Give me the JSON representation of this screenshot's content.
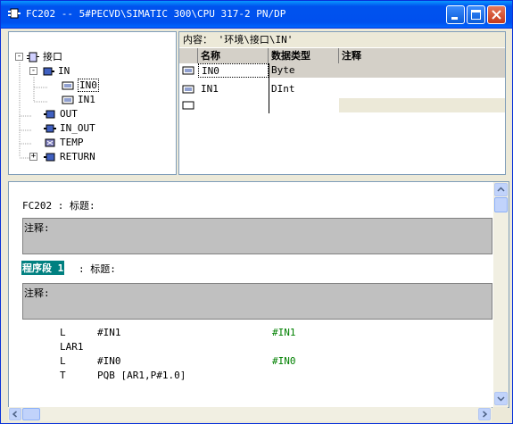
{
  "window": {
    "title": "FC202 -- 5#PECVD\\SIMATIC 300\\CPU 317-2 PN/DP"
  },
  "tree": {
    "items": [
      {
        "label": "接口",
        "icon": "interface-icon",
        "expander": "-"
      },
      {
        "label": "IN",
        "icon": "param-folder-icon",
        "expander": "-"
      },
      {
        "label": "IN0",
        "icon": "param-variable-icon"
      },
      {
        "label": "IN1",
        "icon": "param-variable-icon"
      },
      {
        "label": "OUT",
        "icon": "param-folder-icon"
      },
      {
        "label": "IN_OUT",
        "icon": "param-folder-icon"
      },
      {
        "label": "TEMP",
        "icon": "param-folder-icon"
      },
      {
        "label": "RETURN",
        "icon": "param-folder-icon",
        "expander": "+"
      }
    ]
  },
  "content": {
    "path_label": "内容：  '环境\\接口\\IN'",
    "columns": [
      "名称",
      "数据类型",
      "注释"
    ],
    "rows": [
      {
        "name": "IN0",
        "type": "Byte",
        "comment": ""
      },
      {
        "name": "IN1",
        "type": "DInt",
        "comment": ""
      },
      {
        "name": "",
        "type": "",
        "comment": ""
      }
    ]
  },
  "editor": {
    "block_title": "FC202 : 标题:",
    "block_comment_label": "注释:",
    "network_label": "程序段 1",
    "network_title": ": 标题:",
    "network_comment_label": "注释:",
    "code": [
      {
        "op": "L",
        "operand": "#IN1",
        "comment": "#IN1"
      },
      {
        "op": "LAR1",
        "operand": "",
        "comment": ""
      },
      {
        "op": "L",
        "operand": "#IN0",
        "comment": "#IN0"
      },
      {
        "op": "T",
        "operand": "PQB [AR1,P#1.0]",
        "comment": ""
      }
    ]
  },
  "colors": {
    "titlebar": "#0053ee",
    "network_highlight": "#008080",
    "comment_green": "#008000",
    "gray_box": "#c0c0c0"
  }
}
